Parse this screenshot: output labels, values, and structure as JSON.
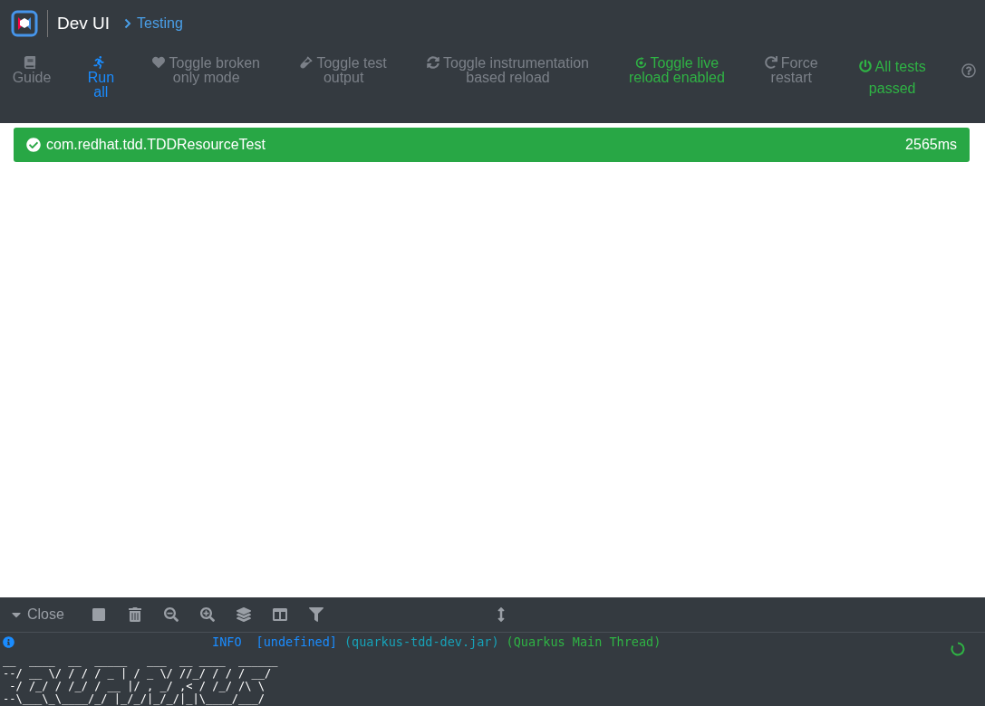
{
  "header": {
    "title": "Dev UI",
    "breadcrumb": "Testing"
  },
  "toolbar": [
    {
      "label": "Guide",
      "kind": "muted"
    },
    {
      "label": "Run all",
      "kind": "active"
    },
    {
      "label": "Toggle broken only mode",
      "kind": "muted"
    },
    {
      "label": "Toggle test output",
      "kind": "muted"
    },
    {
      "label": "Toggle instrumentation based reload",
      "kind": "muted"
    },
    {
      "label": "Toggle live reload enabled",
      "kind": "on"
    },
    {
      "label": "Force restart",
      "kind": "muted"
    },
    {
      "label": "All tests passed",
      "kind": "status"
    }
  ],
  "results": [
    {
      "name": "com.redhat.tdd.TDDResourceTest",
      "time": "2565ms",
      "passed": true
    }
  ],
  "console": {
    "close_label": "Close",
    "log": {
      "level": "INFO",
      "logger": "[undefined]",
      "source": "(quarkus-tdd-dev.jar)",
      "thread": "(Quarkus Main Thread)"
    },
    "banner": "__  ____  __  _____   ___  __ ____  ______ \n--/ __ \\/ / / / _ | / _ \\/ //_/ / / / __/ \n -/ /_/ / /_/ / __ |/ , _/ ,< / /_/ /\\ \\   \n--\\___\\_\\____/_/ |_/_/|_/_/|_|\\____/___/   "
  }
}
